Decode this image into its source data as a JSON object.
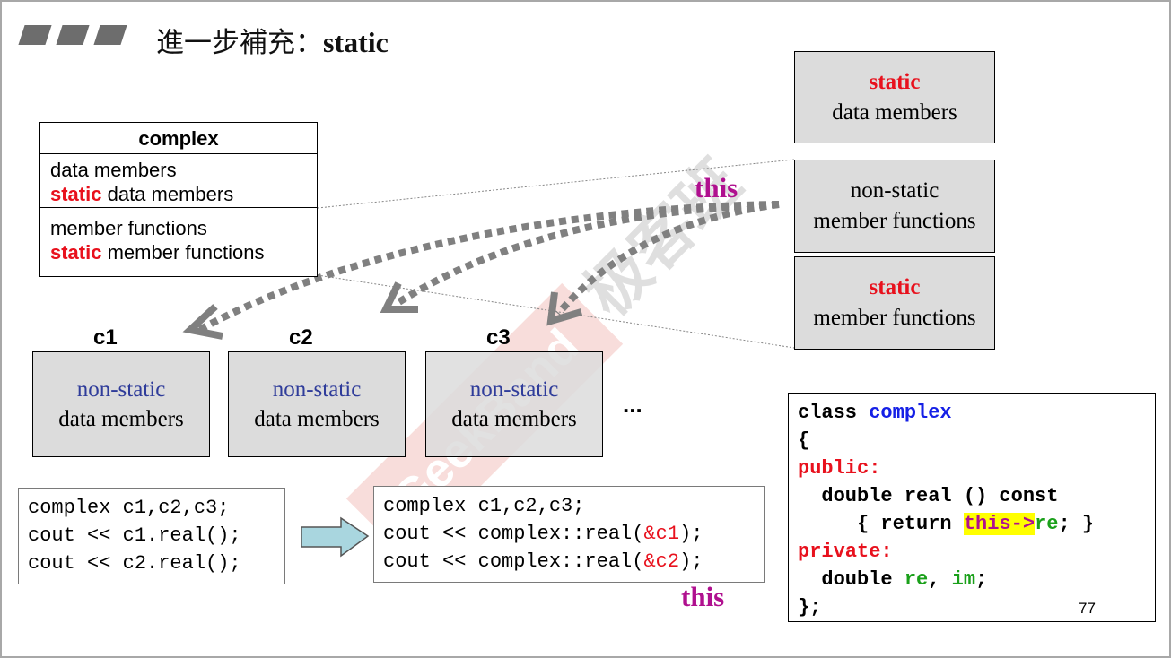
{
  "title": {
    "prefix": "進一步補充：",
    "keyword": "static"
  },
  "class_box": {
    "name": "complex",
    "line1": "data members",
    "line2_kw": "static",
    "line2_rest": " data members",
    "line3": "member functions",
    "line4_kw": "static",
    "line4_rest": " member functions"
  },
  "objects": [
    {
      "label": "c1",
      "line1": "non-static",
      "line2": "data members"
    },
    {
      "label": "c2",
      "line1": "non-static",
      "line2": "data members"
    },
    {
      "label": "c3",
      "line1": "non-static",
      "line2": "data members"
    }
  ],
  "ellipsis": "...",
  "right_boxes": {
    "static_data": {
      "kw": "static",
      "text": "data members"
    },
    "nonstatic_funcs": {
      "line1": "non-static",
      "line2": "member functions"
    },
    "static_funcs": {
      "kw": "static",
      "text": "member functions"
    }
  },
  "this_labels": {
    "top": "this",
    "bottom": "this"
  },
  "code_left": [
    "complex c1,c2,c3;",
    "cout << c1.real();",
    "cout << c2.real();"
  ],
  "code_mid": {
    "line1": "complex c1,c2,c3;",
    "line2_pre": "cout << complex::real(",
    "line2_arg": "&c1",
    "line2_post": ");",
    "line3_pre": "cout << complex::real(",
    "line3_arg": "&c2",
    "line3_post": ");"
  },
  "code_right": {
    "l1_kw": "class ",
    "l1_name": "complex",
    "l2": "{",
    "l3": "public:",
    "l4": "  double real () const",
    "l5_pre": "     { return ",
    "l5_this": "this->",
    "l5_re": "re",
    "l5_post": "; }",
    "l6": "private:",
    "l7_pre": "  double ",
    "l7_re": "re",
    "l7_sep": ", ",
    "l7_im": "im",
    "l7_post": ";",
    "l8": "};"
  },
  "page_number": "77",
  "watermark": "GeekBand 极客班",
  "colors": {
    "static_red": "#e8111d",
    "this_magenta": "#b0108f",
    "nonstatic_blue": "#2f3c9a",
    "box_gray": "#dcdcdc",
    "arrow_gray": "#808080"
  }
}
